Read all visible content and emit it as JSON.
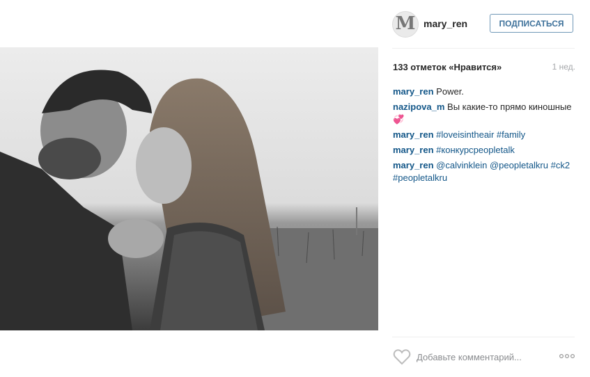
{
  "post": {
    "image_alt": "black and white photo of a couple"
  },
  "header": {
    "avatar_letter": "M",
    "username": "mary_ren",
    "follow_label": "ПОДПИСАТЬСЯ"
  },
  "stats": {
    "likes": "133 отметок «Нравится»",
    "time": "1 нед."
  },
  "comments": [
    {
      "user": "mary_ren",
      "parts": [
        {
          "text": "Power.",
          "tag": false
        }
      ]
    },
    {
      "user": "nazipova_m",
      "parts": [
        {
          "text": "Вы какие-то прямо киношные💞",
          "tag": false
        }
      ]
    },
    {
      "user": "mary_ren",
      "parts": [
        {
          "text": "#loveisintheair",
          "tag": true
        },
        {
          "text": " ",
          "tag": false
        },
        {
          "text": "#family",
          "tag": true
        }
      ]
    },
    {
      "user": "mary_ren",
      "parts": [
        {
          "text": "#конкурс",
          "tag": true
        },
        {
          "text": "peopletalk",
          "tag": true
        }
      ]
    },
    {
      "user": "mary_ren",
      "parts": [
        {
          "text": "@calvinklein",
          "tag": true
        },
        {
          "text": " ",
          "tag": false
        },
        {
          "text": "@peopletalkru",
          "tag": true
        },
        {
          "text": " ",
          "tag": false
        },
        {
          "text": "#ck2",
          "tag": true
        },
        {
          "text": " ",
          "tag": false
        },
        {
          "text": "#peopletalkru",
          "tag": true
        }
      ]
    }
  ],
  "footer": {
    "comment_placeholder": "Добавьте комментарий...",
    "heart_icon": "heart-outline-icon",
    "more_icon": "more-dots-icon"
  },
  "colors": {
    "link": "#125688",
    "button_text": "#3f729b",
    "muted": "#a5a7aa"
  }
}
